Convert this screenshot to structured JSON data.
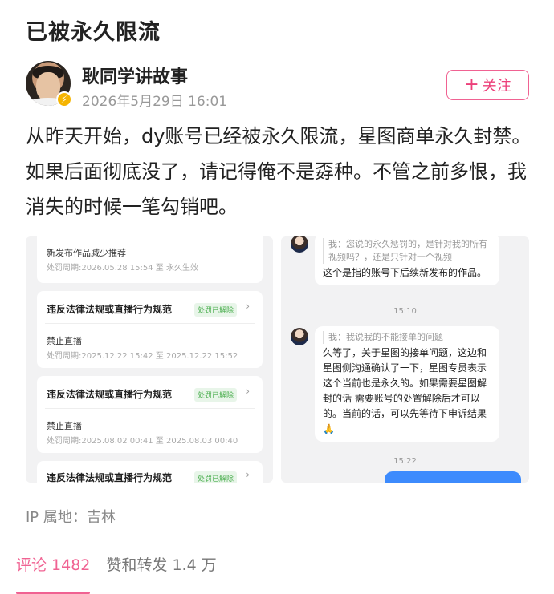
{
  "page": {
    "title": "已被永久限流"
  },
  "author": {
    "name": "耿同学讲故事",
    "time": "2026年5月29日 16:01",
    "follow_label": "关注",
    "follow_icon": "plus-icon",
    "badge_icon": "lightning-icon"
  },
  "content": {
    "text": "从昨天开始，dy账号已经被永久限流，星图商单永久封禁。如果后面彻底没了，请记得俺不是孬种。不管之前多恨，我消失的时候一笔勾销吧。"
  },
  "left_shot": {
    "top_card": {
      "item": "新发布作品减少推荐",
      "period": "处罚周期:2026.05.28 15:54 至 永久生效"
    },
    "cards": [
      {
        "title": "违反法律法规或直播行为规范",
        "status": "处罚已解除",
        "item": "禁止直播",
        "period": "处罚周期:2025.12.22 15:42 至 2025.12.22 15:52"
      },
      {
        "title": "违反法律法规或直播行为规范",
        "status": "处罚已解除",
        "item": "禁止直播",
        "period": "处罚周期:2025.08.02 00:41 至 2025.08.03 00:40"
      },
      {
        "title": "违反法律法规或直播行为规范",
        "status": "处罚已解除"
      }
    ]
  },
  "right_shot": {
    "msg1": {
      "quote": "我：您说的永久惩罚的，是针对我的所有视频吗？，还是只针对一个视频",
      "reply": "这个是指的账号下后续新发布的作品。"
    },
    "time1": "15:10",
    "msg2": {
      "quote": "我：我说我的不能接单的问题",
      "reply": "久等了，关于星图的接单问题，这边和星图侧沟通确认了一下，星图专员表示这个当前也是永久的。如果需要星图解封的话 需要账号的处置解除后才可以的。当前的话，可以先等待下申诉结果 🙏"
    },
    "time2": "15:22"
  },
  "footer": {
    "ip_label": "IP 属地：吉林",
    "tab_comments": "评论 1482",
    "tab_likes": "赞和转发 1.4 万"
  },
  "colors": {
    "accent": "#f06292",
    "success": "#4caf50",
    "chat_blue": "#3d8bfd"
  }
}
